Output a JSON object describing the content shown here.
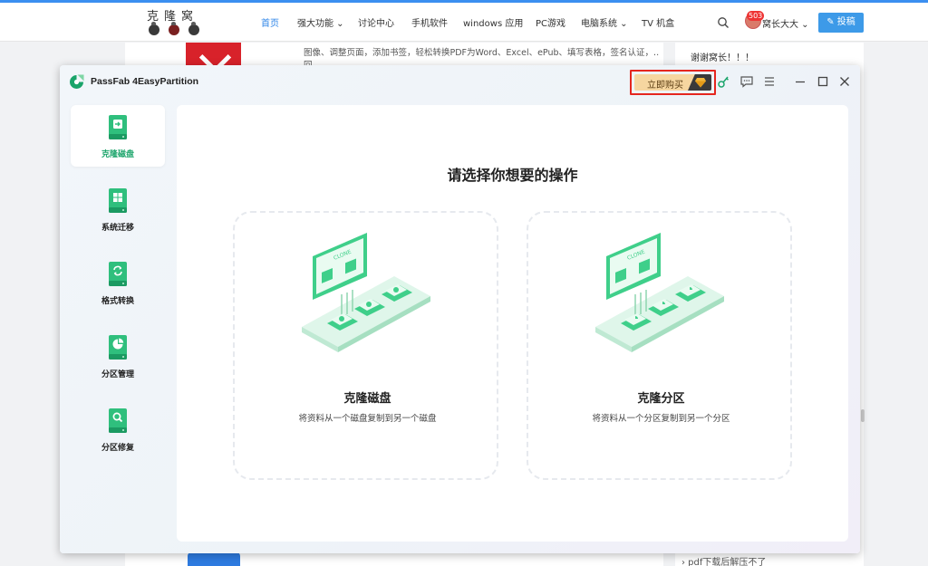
{
  "site": {
    "logo_text": "克隆窝",
    "nav": [
      {
        "label": "首页",
        "active": true
      },
      {
        "label": "强大功能",
        "dropdown": true
      },
      {
        "label": "讨论中心"
      },
      {
        "label": "手机软件"
      },
      {
        "label": "windows 应用"
      },
      {
        "label": "PC游戏"
      },
      {
        "label": "电脑系统",
        "dropdown": true
      },
      {
        "label": "TV 机盒"
      }
    ],
    "notification_count": "503",
    "username": "窝长大大",
    "post_button": "投稿",
    "snippet": "图像、调整页面，添加书签，轻松转换PDF为Word、Excel、ePub、填写表格，签名认证，...",
    "snippet_more": "回",
    "sidebar_text": "谢谢窝长！！！",
    "sidebar_link": "› pdf下载后解压不了"
  },
  "app": {
    "title": "PassFab 4EasyPartition",
    "buy_label": "立即购买",
    "colors": {
      "accent": "#1aa46a",
      "buy_bg": "#f6d6a0",
      "highlight": "#e5261f"
    },
    "titlebar_icons": [
      "key-icon",
      "feedback-icon",
      "menu-icon",
      "minimize-icon",
      "maximize-icon",
      "close-icon"
    ],
    "sidebar": [
      {
        "label": "克隆磁盘",
        "icon": "clone-disk-icon",
        "active": true
      },
      {
        "label": "系统迁移",
        "icon": "system-migrate-icon",
        "active": false
      },
      {
        "label": "格式转换",
        "icon": "format-convert-icon",
        "active": false
      },
      {
        "label": "分区管理",
        "icon": "partition-manage-icon",
        "active": false
      },
      {
        "label": "分区修复",
        "icon": "partition-repair-icon",
        "active": false
      }
    ],
    "main": {
      "heading": "请选择你想要的操作",
      "options": [
        {
          "title": "克隆磁盘",
          "description": "将资料从一个磁盘复制到另一个磁盘",
          "illustration_label": "CLONE"
        },
        {
          "title": "克隆分区",
          "description": "将资料从一个分区复制到另一个分区",
          "illustration_label": "CLONE"
        }
      ]
    }
  }
}
